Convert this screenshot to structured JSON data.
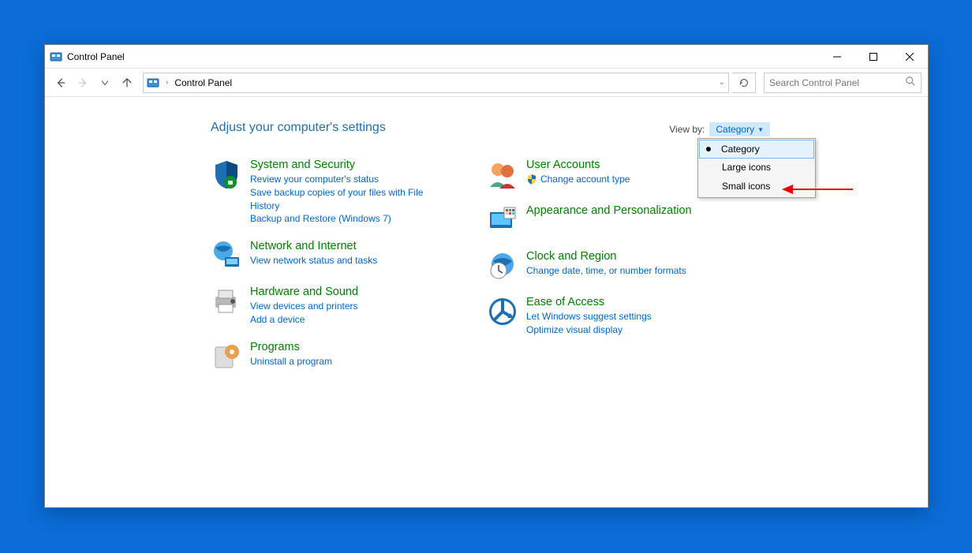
{
  "window": {
    "title": "Control Panel"
  },
  "breadcrumb": {
    "root": "Control Panel"
  },
  "search": {
    "placeholder": "Search Control Panel"
  },
  "heading": "Adjust your computer's settings",
  "viewby": {
    "label": "View by:",
    "current": "Category",
    "options": {
      "category": "Category",
      "large": "Large icons",
      "small": "Small icons"
    }
  },
  "categories": {
    "left": [
      {
        "name": "System and Security",
        "sublinks": [
          "Review your computer's status",
          "Save backup copies of your files with File History",
          "Backup and Restore (Windows 7)"
        ]
      },
      {
        "name": "Network and Internet",
        "sublinks": [
          "View network status and tasks"
        ]
      },
      {
        "name": "Hardware and Sound",
        "sublinks": [
          "View devices and printers",
          "Add a device"
        ]
      },
      {
        "name": "Programs",
        "sublinks": [
          "Uninstall a program"
        ]
      }
    ],
    "right": [
      {
        "name": "User Accounts",
        "sublinks_shielded": [
          "Change account type"
        ]
      },
      {
        "name": "Appearance and Personalization",
        "sublinks": []
      },
      {
        "name": "Clock and Region",
        "sublinks": [
          "Change date, time, or number formats"
        ]
      },
      {
        "name": "Ease of Access",
        "sublinks": [
          "Let Windows suggest settings",
          "Optimize visual display"
        ]
      }
    ]
  }
}
